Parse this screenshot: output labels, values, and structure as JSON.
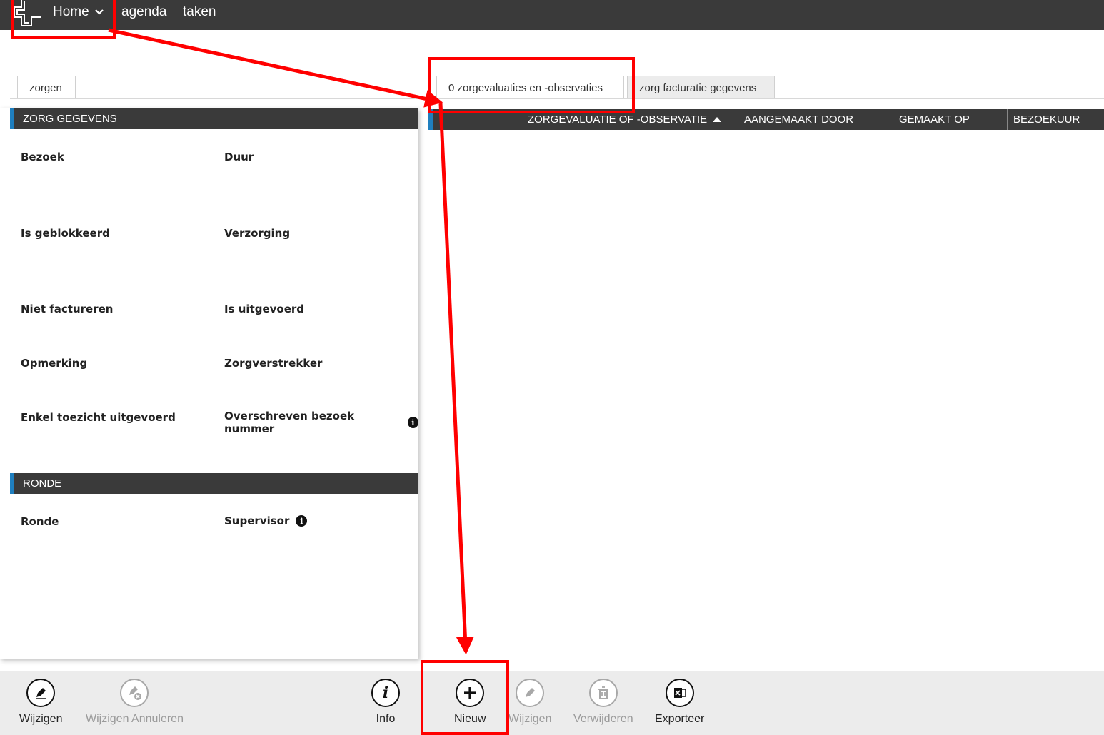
{
  "nav": {
    "home_label": "Home",
    "agenda_label": "agenda",
    "taken_label": "taken"
  },
  "tabs": {
    "left": "zorgen",
    "observations": "0 zorgevaluaties en -observaties",
    "billing": "zorg facturatie gegevens"
  },
  "zorg_gegevens": {
    "title": "ZORG GEGEVENS",
    "fields": {
      "bezoek": "Bezoek",
      "duur": "Duur",
      "is_geblokkeerd": "Is geblokkeerd",
      "verzorging": "Verzorging",
      "niet_factureren": "Niet factureren",
      "is_uitgevoerd": "Is uitgevoerd",
      "opmerking": "Opmerking",
      "zorgverstrekker": "Zorgverstrekker",
      "enkel_toezicht": "Enkel toezicht uitgevoerd",
      "overschreven_bezoek": "Overschreven bezoek nummer"
    }
  },
  "ronde": {
    "title": "RONDE",
    "fields": {
      "ronde": "Ronde",
      "supervisor": "Supervisor"
    }
  },
  "grid": {
    "columns": [
      "ZORGEVALUATIE OF -OBSERVATIE",
      "AANGEMAAKT DOOR",
      "GEMAAKT OP",
      "BEZOEKUUR"
    ]
  },
  "toolbar": {
    "wijzigen": "Wijzigen",
    "wijzigen_annuleren": "Wijzigen Annuleren",
    "info": "Info",
    "nieuw": "Nieuw",
    "wijzigen2": "Wijzigen",
    "verwijderen": "Verwijderen",
    "exporteer": "Exporteer"
  },
  "colors": {
    "header_bg": "#3a3a3a",
    "accent_blue": "#1f7fbf",
    "annotation_red": "#ff0000",
    "toolbar_bg": "#ececec"
  }
}
